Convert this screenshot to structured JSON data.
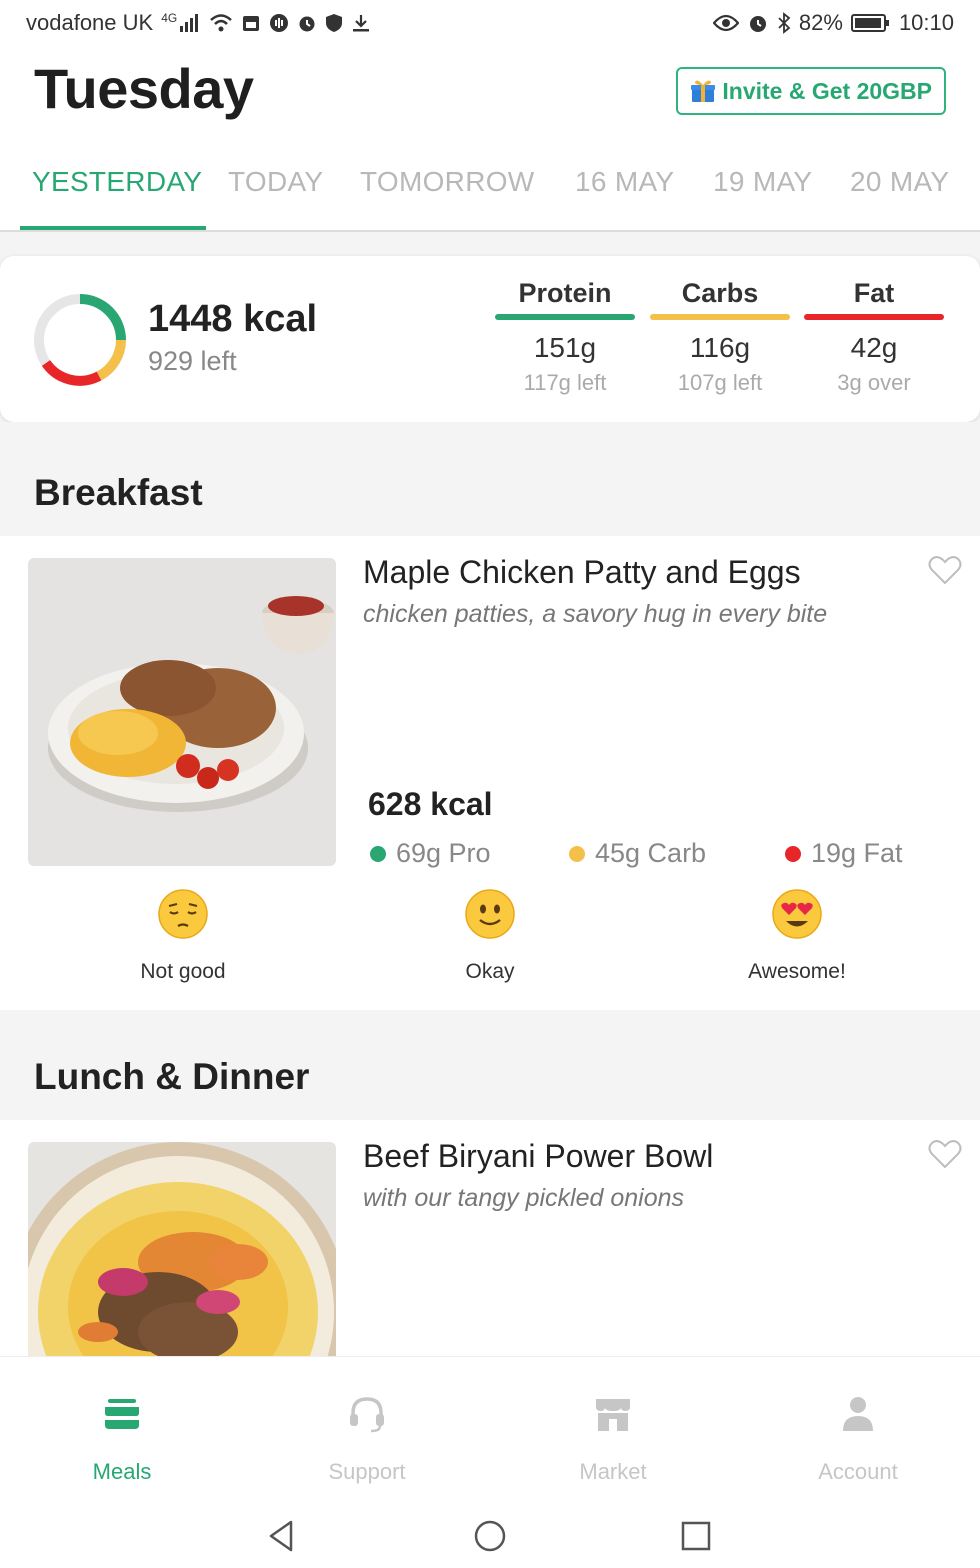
{
  "status_bar": {
    "carrier": "vodafone UK",
    "network": "4G",
    "battery": "82%",
    "time": "10:10"
  },
  "header": {
    "title": "Tuesday",
    "invite_label": "Invite & Get 20GBP"
  },
  "tabs": [
    {
      "label": "YESTERDAY",
      "active": true
    },
    {
      "label": "TODAY",
      "active": false
    },
    {
      "label": "TOMORROW",
      "active": false
    },
    {
      "label": "16 MAY",
      "active": false
    },
    {
      "label": "19 MAY",
      "active": false
    },
    {
      "label": "20 MAY",
      "active": false
    }
  ],
  "summary": {
    "kcal": "1448 kcal",
    "kcal_left": "929 left",
    "macros": [
      {
        "name": "Protein",
        "value": "151g",
        "sub": "117g left",
        "color": "#2aa672"
      },
      {
        "name": "Carbs",
        "value": "116g",
        "sub": "107g left",
        "color": "#f4c04a"
      },
      {
        "name": "Fat",
        "value": "42g",
        "sub": "3g over",
        "color": "#e8262a"
      }
    ]
  },
  "sections": {
    "breakfast_title": "Breakfast",
    "lunch_title": "Lunch & Dinner"
  },
  "breakfast_meal": {
    "name": "Maple Chicken Patty and Eggs",
    "description": "chicken patties, a savory hug in every bite",
    "kcal": "628 kcal",
    "protein": "69g Pro",
    "carbs": "45g Carb",
    "fat": "19g Fat"
  },
  "ratings": [
    {
      "label": "Not good",
      "icon": "pensive-face-icon"
    },
    {
      "label": "Okay",
      "icon": "slight-smile-face-icon"
    },
    {
      "label": "Awesome!",
      "icon": "heart-eyes-face-icon"
    }
  ],
  "lunch_meal": {
    "name": "Beef Biryani Power Bowl",
    "description": "with our tangy pickled onions"
  },
  "bottom_nav": [
    {
      "label": "Meals",
      "icon": "meals-icon",
      "active": true
    },
    {
      "label": "Support",
      "icon": "headset-icon",
      "active": false
    },
    {
      "label": "Market",
      "icon": "store-icon",
      "active": false
    },
    {
      "label": "Account",
      "icon": "person-icon",
      "active": false
    }
  ],
  "colors": {
    "accent": "#27a873",
    "protein": "#2aa672",
    "carbs": "#f4c04a",
    "fat": "#e8262a"
  }
}
